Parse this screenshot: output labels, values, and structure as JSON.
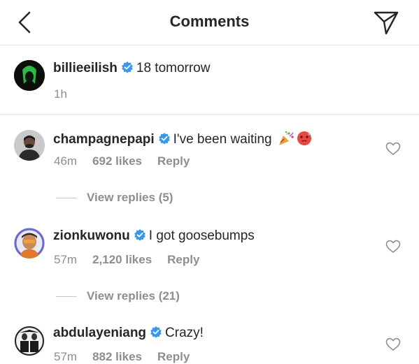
{
  "header": {
    "title": "Comments",
    "back_icon": "chevron-left-icon",
    "send_icon": "paper-plane-icon"
  },
  "caption": {
    "username": "billieeilish",
    "text": "18 tomorrow",
    "time": "1h",
    "verified": true
  },
  "comments": [
    {
      "username": "champagnepapi",
      "text": "I've been waiting",
      "emojis": [
        "party-popper-icon",
        "hot-face-icon"
      ],
      "time": "46m",
      "likes": "692 likes",
      "reply": "Reply",
      "view_replies": "View replies (5)",
      "verified": true
    },
    {
      "username": "zionkuwonu",
      "text": "I got goosebumps",
      "time": "57m",
      "likes": "2,120 likes",
      "reply": "Reply",
      "view_replies": "View replies (21)",
      "verified": true
    },
    {
      "username": "abdulayeniang",
      "text": "Crazy!",
      "time": "57m",
      "likes": "882 likes",
      "reply": "Reply",
      "verified": true
    }
  ],
  "colors": {
    "text": "#262626",
    "secondary": "#8e8e8e",
    "verified": "#3897f0",
    "divider": "#e3e3e3"
  }
}
